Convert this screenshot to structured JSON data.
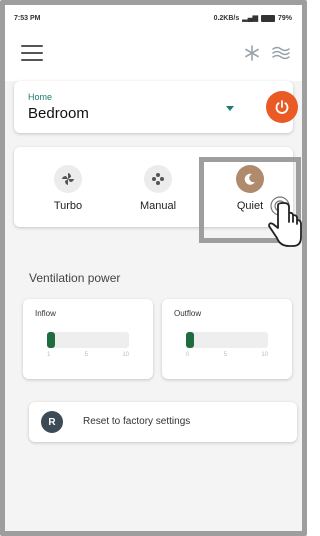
{
  "status_bar": {
    "time": "7:53 PM",
    "net_speed": "0.2KB/s",
    "battery": "79%"
  },
  "location": {
    "home_label": "Home",
    "room": "Bedroom"
  },
  "modes": [
    {
      "label": "Turbo"
    },
    {
      "label": "Manual"
    },
    {
      "label": "Quiet",
      "selected": true
    }
  ],
  "ventilation": {
    "title": "Ventilation power",
    "inflow": {
      "title": "Inflow",
      "level": 0.1,
      "ticks": [
        "1",
        "5",
        "10"
      ]
    },
    "outflow": {
      "title": "Outflow",
      "level": 0.1,
      "ticks": [
        "0",
        "5",
        "10"
      ]
    }
  },
  "reset": {
    "avatar_letter": "R",
    "label": "Reset to factory settings"
  },
  "colors": {
    "accent": "#1b7c74",
    "power": "#ea5a24",
    "flow": "#1f6c3f",
    "quiet": "#b08a6d"
  }
}
